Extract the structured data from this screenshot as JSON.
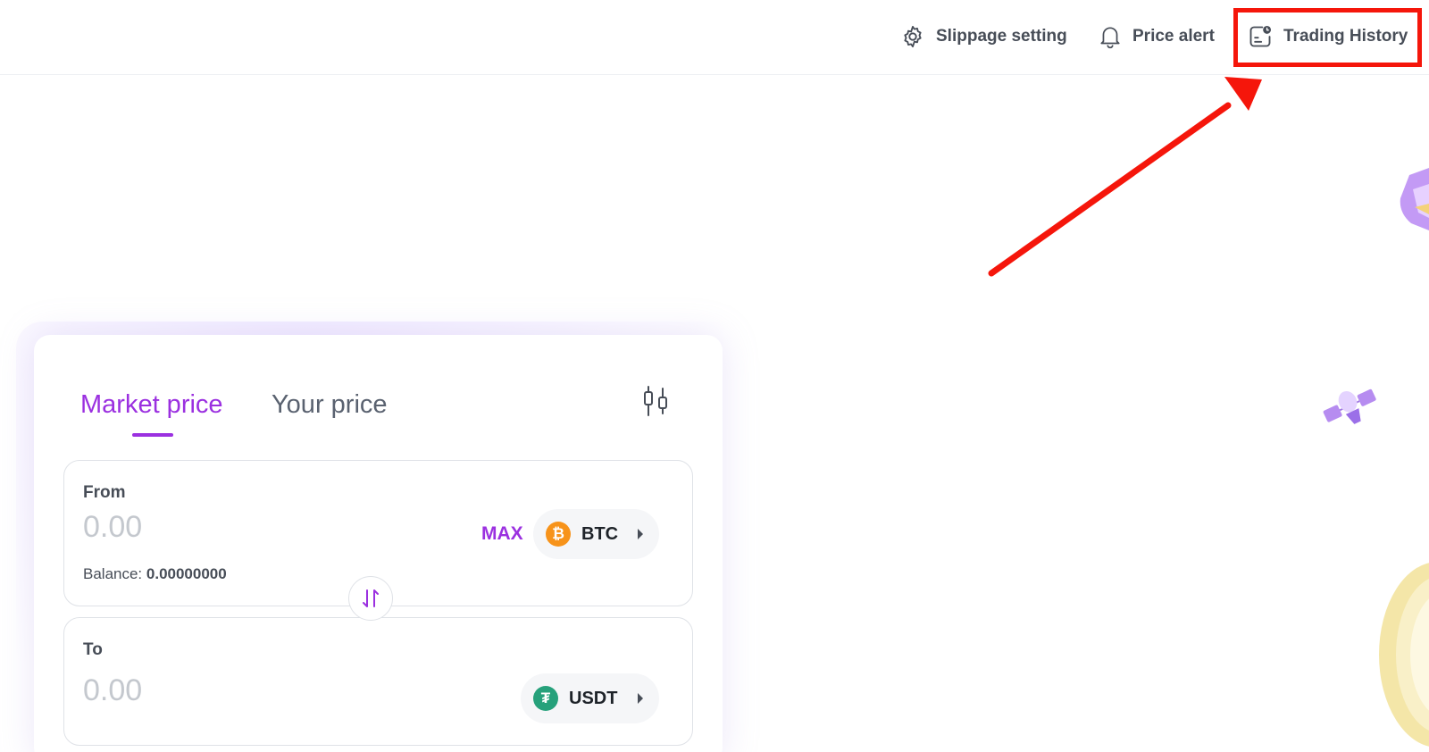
{
  "header": {
    "nav": [
      {
        "label": "Slippage setting",
        "icon": "gear-icon"
      },
      {
        "label": "Price alert",
        "icon": "bell-icon"
      },
      {
        "label": "Trading History",
        "icon": "history-icon"
      }
    ]
  },
  "annotation": {
    "highlight_color": "#f5160b"
  },
  "swap": {
    "tabs": [
      {
        "label": "Market price",
        "active": true
      },
      {
        "label": "Your price",
        "active": false
      }
    ],
    "from": {
      "label": "From",
      "placeholder": "0.00",
      "balance_label": "Balance: ",
      "balance_value": "0.00000000",
      "max_label": "MAX",
      "token": "BTC",
      "token_icon": "bitcoin-icon"
    },
    "to": {
      "label": "To",
      "placeholder": "0.00",
      "token": "USDT",
      "token_icon": "tether-icon"
    }
  },
  "colors": {
    "accent": "#9b30e0",
    "text_muted": "#474d57",
    "btc": "#f7931a",
    "usdt": "#26a17b"
  }
}
